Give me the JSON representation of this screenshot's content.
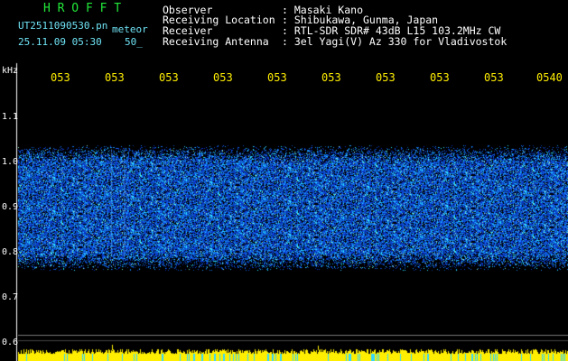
{
  "header": {
    "brand": "H R O F F T",
    "filename": "UT2511090530.pn",
    "mode": "meteor",
    "datetime": "25.11.09 05:30",
    "counter": "50_",
    "info": [
      {
        "label": "Observer",
        "value": ": Masaki Kano"
      },
      {
        "label": "Receiving Location",
        "value": ": Shibukawa, Gunma, Japan"
      },
      {
        "label": "Receiver",
        "value": ": RTL-SDR SDR# 43dB L15 103.2MHz CW"
      },
      {
        "label": "Receiving Antenna",
        "value": ": 3el Yagi(V) Az 330 for Vladivostok"
      }
    ]
  },
  "freq_axis": {
    "unit": "kHz",
    "ticks": [
      "1.1",
      "1.0",
      "0.9",
      "0.8",
      "0.7",
      "0.6"
    ]
  },
  "time_axis": {
    "ticks": [
      "053",
      "053",
      "053",
      "053",
      "053",
      "053",
      "053",
      "053",
      "053",
      "0540"
    ]
  },
  "colors": {
    "background": "#000000",
    "header_green": "#22e83a",
    "header_cyan": "#6fe3f5",
    "time_yellow": "#ffee00",
    "noise_blue": "#1a4dff",
    "noise_cyan": "#33e0ff"
  }
}
